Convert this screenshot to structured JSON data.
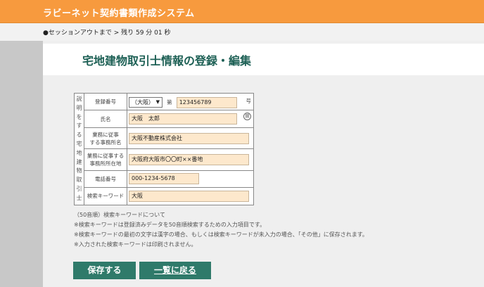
{
  "header": {
    "app_title": "ラビーネット契約書類作成システム"
  },
  "session": {
    "text": "●セッションアウトまで > 残り 59 分 01 秒"
  },
  "page": {
    "title": "宅地建物取引士情報の登録・編集"
  },
  "form": {
    "side_label": [
      "説",
      "明",
      "を",
      "す",
      "る",
      "宅",
      "地",
      "建",
      "物",
      "取",
      "引",
      "士"
    ],
    "reg_number": {
      "label": "登録番号",
      "prefecture": "（大阪）",
      "dai": "第",
      "number": "123456789",
      "go": "号"
    },
    "name": {
      "label": "氏名",
      "value": "大阪　太郎",
      "icon": "search-icon"
    },
    "office_name": {
      "label": [
        "業務に従事",
        "する事務所名"
      ],
      "value": "大阪不動産株式会社"
    },
    "office_address": {
      "label": [
        "業務に従事する",
        "事務所所在地"
      ],
      "value": "大阪府大阪市〇〇町××番地"
    },
    "phone": {
      "label": "電話番号",
      "value": "000-1234-5678"
    },
    "keyword": {
      "label": "検索キーワード",
      "value": "大阪"
    }
  },
  "notes": [
    "（50音順）検索キーワードについて",
    "※検索キーワードは登録済みデータを50音順検索するための入力項目です。",
    "※検索キーワードの最初の文字は漢字の場合、もしくは検索キーワードが未入力の場合、「その他」に保存されます。",
    "※入力された検索キーワードは印刷されません。"
  ],
  "buttons": {
    "save": "保存する",
    "back": "一覧に戻る"
  }
}
